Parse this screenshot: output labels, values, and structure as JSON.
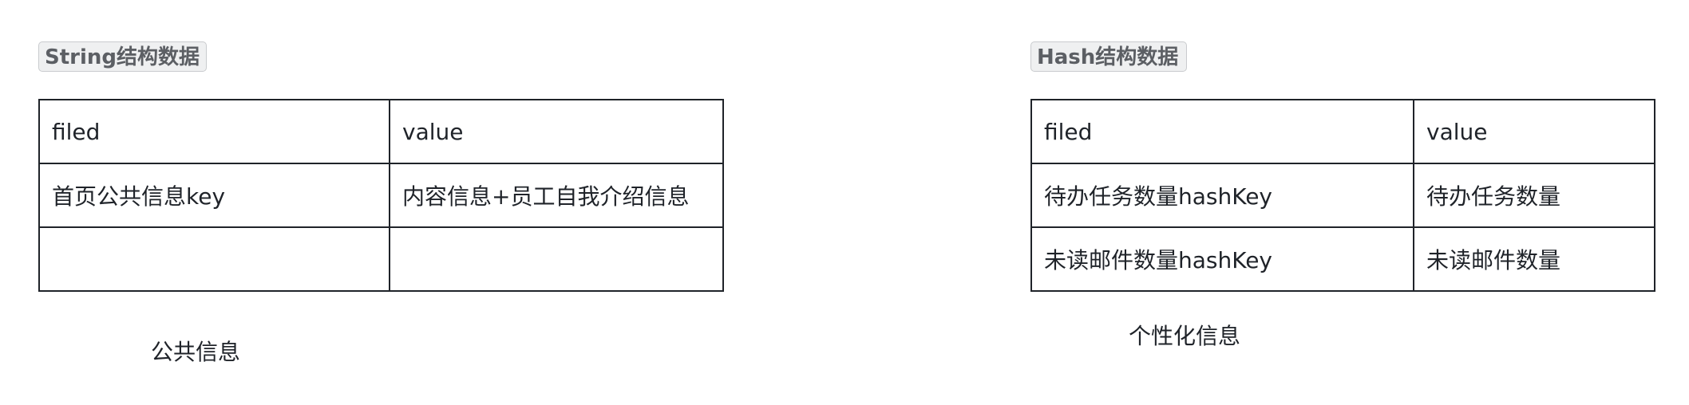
{
  "string_structure": {
    "badge": "String结构数据",
    "table": {
      "rows": [
        [
          "filed",
          "value"
        ],
        [
          "首页公共信息key",
          "内容信息+员工自我介绍信息"
        ],
        [
          "",
          ""
        ]
      ]
    },
    "caption": "公共信息"
  },
  "hash_structure": {
    "badge": "Hash结构数据",
    "table": {
      "rows": [
        [
          "filed",
          "value"
        ],
        [
          "待办任务数量hashKey",
          "待办任务数量"
        ],
        [
          "未读邮件数量hashKey",
          "未读邮件数量"
        ]
      ]
    },
    "caption": "个性化信息"
  },
  "colors": {
    "badge_background": "#eff0f1",
    "badge_border": "#c9cbce",
    "badge_text": "#5c5f64",
    "table_border": "#1f2329",
    "text": "#1f2329"
  }
}
